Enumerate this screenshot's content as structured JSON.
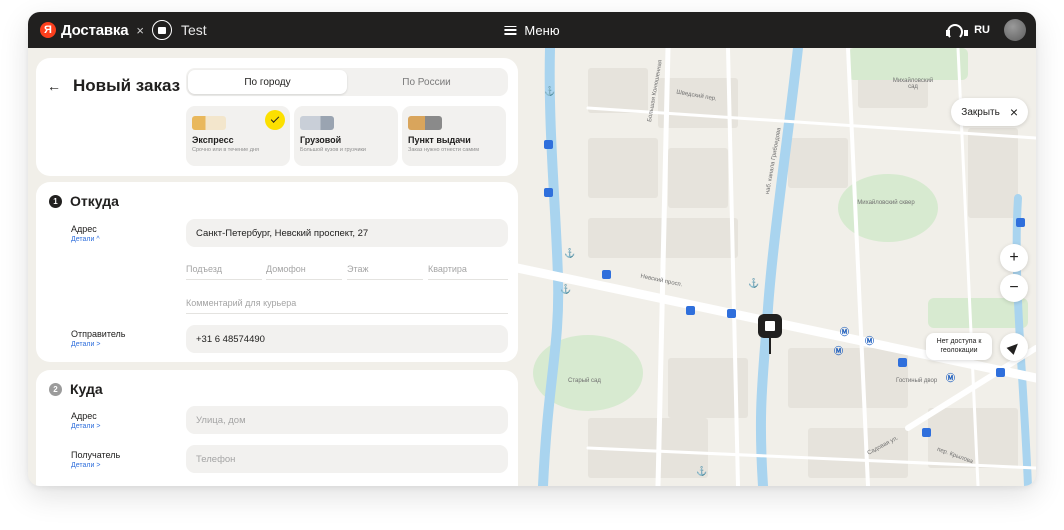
{
  "topbar": {
    "brand_letter": "Я",
    "brand_name": "Доставка",
    "separator": "×",
    "partner_name": "Test",
    "menu_label": "Меню",
    "lang": "RU"
  },
  "order": {
    "back": "←",
    "title": "Новый заказ",
    "tabs": [
      {
        "label": "По городу",
        "active": true
      },
      {
        "label": "По России",
        "active": false
      }
    ],
    "tariffs": [
      {
        "name": "Экспресс",
        "desc": "Срочно или в течение дня",
        "selected": true,
        "color": "#f0c35a"
      },
      {
        "name": "Грузовой",
        "desc": "Большой кузов и грузчики",
        "selected": false,
        "color": "#d9dde4"
      },
      {
        "name": "Пункт выдачи",
        "desc": "Заказ нужно отнести самим",
        "selected": false,
        "color": "#e0b36f"
      }
    ]
  },
  "from": {
    "number": "1",
    "title": "Откуда",
    "address_label": "Адрес",
    "details_label": "Детали ^",
    "address_value": "Санкт-Петербург, Невский проспект, 27",
    "entrance_placeholder": "Подъезд",
    "intercom_placeholder": "Домофон",
    "floor_placeholder": "Этаж",
    "apartment_placeholder": "Квартира",
    "comment_placeholder": "Комментарий для курьера",
    "sender_label": "Отправитель",
    "sender_details": "Детали >",
    "sender_phone": "+31 6 48574490"
  },
  "to": {
    "number": "2",
    "title": "Куда",
    "address_label": "Адрес",
    "details_label": "Детали >",
    "address_placeholder": "Улица, дом",
    "recipient_label": "Получатель",
    "recipient_details": "Детали >",
    "phone_placeholder": "Телефон"
  },
  "map": {
    "close_label": "Закрыть",
    "close_icon": "×",
    "zoom_in": "+",
    "zoom_out": "−",
    "geo_note": "Нет доступа к геолокации",
    "labels": {
      "nevsky": "Невский просп.",
      "mikh_garden": "Михайловский сад",
      "mikh_square": "Михайловский сквер",
      "old_garden": "Старый сад",
      "gostiny": "Гостиный двор",
      "konushennaya": "Большая Конюшенная",
      "shvedsky": "Шведский пер.",
      "griboedov": "наб. канала Грибоедова",
      "sadovaya": "Садовая ул.",
      "lomonosova": "пер. Крылова"
    },
    "colors": {
      "land": "#f1efe9",
      "road": "#ffffff",
      "water": "#a9d4ef",
      "park": "#d7ead0",
      "block": "#e6e3dc"
    }
  }
}
